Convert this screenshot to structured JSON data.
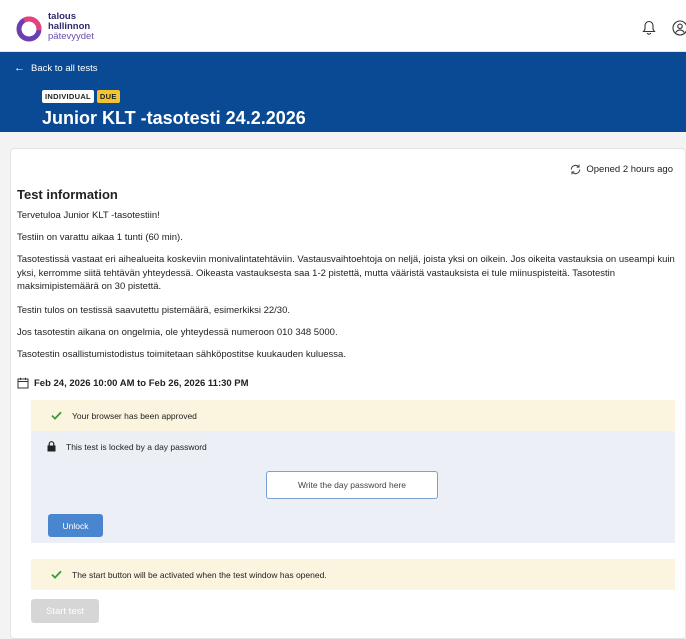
{
  "header": {
    "logo_lines": [
      "talous",
      "hallinnon",
      "pätevyydet"
    ],
    "icons": [
      "bell-icon",
      "user-icon"
    ]
  },
  "hero": {
    "back_label": "Back to all tests",
    "badges": [
      "INDIVIDUAL",
      "DUE"
    ],
    "title": "Junior KLT -tasotesti 24.2.2026"
  },
  "status": {
    "opened": "Opened 2 hours ago"
  },
  "info": {
    "title": "Test information",
    "paragraphs": [
      "Tervetuloa Junior KLT -tasotestiin!",
      "Testiin on varattu aikaa 1 tunti (60 min).",
      "Tasotestissä vastaat eri aihealueita koskeviin monivalintatehtäviin. Vastausvaihtoehtoja on neljä, joista yksi on oikein. Jos oikeita vastauksia on useampi kuin yksi, kerromme siitä tehtävän yhteydessä. Oikeasta vastauksesta saa 1-2 pistettä, mutta vääristä vastauksista ei tule miinuspisteitä. Tasotestin maksimipistemäärä on 30 pistettä.",
      "Testin tulos on testissä saavutettu pistemäärä, esimerkiksi 22/30.",
      "Jos tasotestin aikana on ongelmia, ole yhteydessä numeroon 010 348 5000.",
      "Tasotestin osallistumistodistus toimitetaan sähköpostitse kuukauden kuluessa."
    ],
    "date_range": "Feb 24, 2026 10:00 AM to Feb 26, 2026 11:30 PM"
  },
  "checks": {
    "browser": "Your browser has been approved",
    "lock": "This test is locked by a day password",
    "password_placeholder": "Write the day password here",
    "unlock_label": "Unlock",
    "start_notice": "The start button will be activated when the test window has opened."
  },
  "start_label": "Start test",
  "colors": {
    "brand_blue": "#0a4a94",
    "due_badge": "#f3c431",
    "notice_bg": "#fbf4df",
    "success_green": "#3a9a3a",
    "unlock_blue": "#4a86d0"
  }
}
